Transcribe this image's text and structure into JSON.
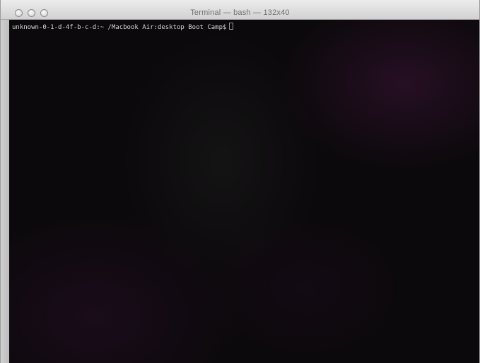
{
  "window": {
    "title": "Terminal — bash — 132x40"
  },
  "terminal": {
    "prompt": "unknown-0-1-d-4f-b-c-d:~ /Macbook Air:desktop Boot Camp$"
  },
  "icons": {
    "close": "close-button-icon",
    "minimize": "minimize-button-icon",
    "zoom": "zoom-button-icon",
    "cursor": "block-cursor-icon"
  },
  "colors": {
    "terminal_background": "#0b090b",
    "terminal_text": "#d9d9d9",
    "titlebar_text": "#6f6f6f"
  }
}
